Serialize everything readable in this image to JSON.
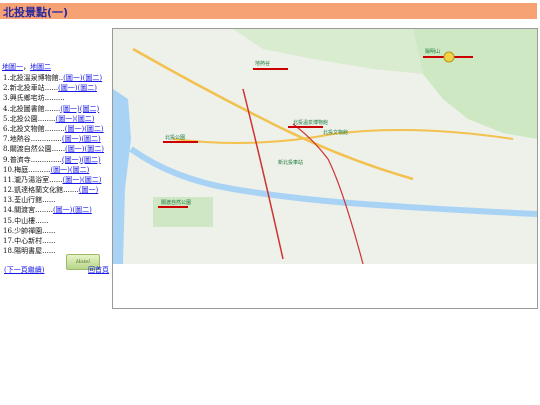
{
  "page": {
    "title": "北投景點(一)"
  },
  "map_links": {
    "map1": "地圖一",
    "sep": "，",
    "map2": "地圖二"
  },
  "list": [
    {
      "num": "1.",
      "name": "北投溫泉博物館",
      "dots": "..",
      "l1": "(圖一)",
      "l2": "(圖二)"
    },
    {
      "num": "2.",
      "name": "新北投車站",
      "dots": "......",
      "l1": "(圖一)",
      "l2": "(圖二)"
    },
    {
      "num": "3.",
      "name": "興氏鄉宅坊",
      "dots": ".........",
      "l1": "",
      "l2": ""
    },
    {
      "num": "4.",
      "name": "北投圖書館",
      "dots": ".......",
      "l1": "(圖一)",
      "l2": "(圖二)"
    },
    {
      "num": "5.",
      "name": "北投公園",
      "dots": "........",
      "l1": "(圖一)",
      "l2": "(圖二)"
    },
    {
      "num": "6.",
      "name": "北投文物館",
      "dots": ".........",
      "l1": "(圖一)",
      "l2": "(圖二)"
    },
    {
      "num": "7.",
      "name": "地熱谷",
      "dots": "..............",
      "l1": "(圖一)",
      "l2": "(圖二)"
    },
    {
      "num": "8.",
      "name": "關渡自然公園",
      "dots": "......",
      "l1": "(圖一)",
      "l2": "(圖二)"
    },
    {
      "num": "9.",
      "name": "普濟寺",
      "dots": "..............",
      "l1": "(圖一)",
      "l2": "(圖二)"
    },
    {
      "num": "10.",
      "name": "梅庭",
      "dots": "..........",
      "l1": "(圖一)",
      "l2": "(圖二)"
    },
    {
      "num": "11.",
      "name": "瀧乃湯浴室",
      "dots": "......",
      "l1": "(圖一)",
      "l2": "(圖二)"
    },
    {
      "num": "12.",
      "name": "凱達格蘭文化館",
      "dots": ".......",
      "l1": "(圖一)",
      "l2": ""
    },
    {
      "num": "13.",
      "name": "荃山行館",
      "dots": "......",
      "l1": "",
      "l2": ""
    },
    {
      "num": "14.",
      "name": "關渡宮",
      "dots": "........",
      "l1": "(圖一)",
      "l2": "(圖二)"
    },
    {
      "num": "15.",
      "name": "中山樓",
      "dots": "......",
      "l1": "",
      "l2": ""
    },
    {
      "num": "16.",
      "name": "少帥禪園",
      "dots": "......",
      "l1": "",
      "l2": ""
    },
    {
      "num": "17.",
      "name": "中心新村",
      "dots": "......",
      "l1": "",
      "l2": ""
    },
    {
      "num": "18.",
      "name": "陽明書屋",
      "dots": "......",
      "l1": "",
      "l2": ""
    }
  ],
  "bottom": {
    "next": "(下一頁繼續)",
    "home": "回首頁"
  },
  "map": {
    "labels": [
      {
        "text": "北投溫泉博物館"
      },
      {
        "text": "北投文物館"
      },
      {
        "text": "地熱谷"
      },
      {
        "text": "關渡自然公園"
      },
      {
        "text": "新北投車站"
      },
      {
        "text": "北投公園"
      },
      {
        "text": "陽明山"
      }
    ]
  }
}
